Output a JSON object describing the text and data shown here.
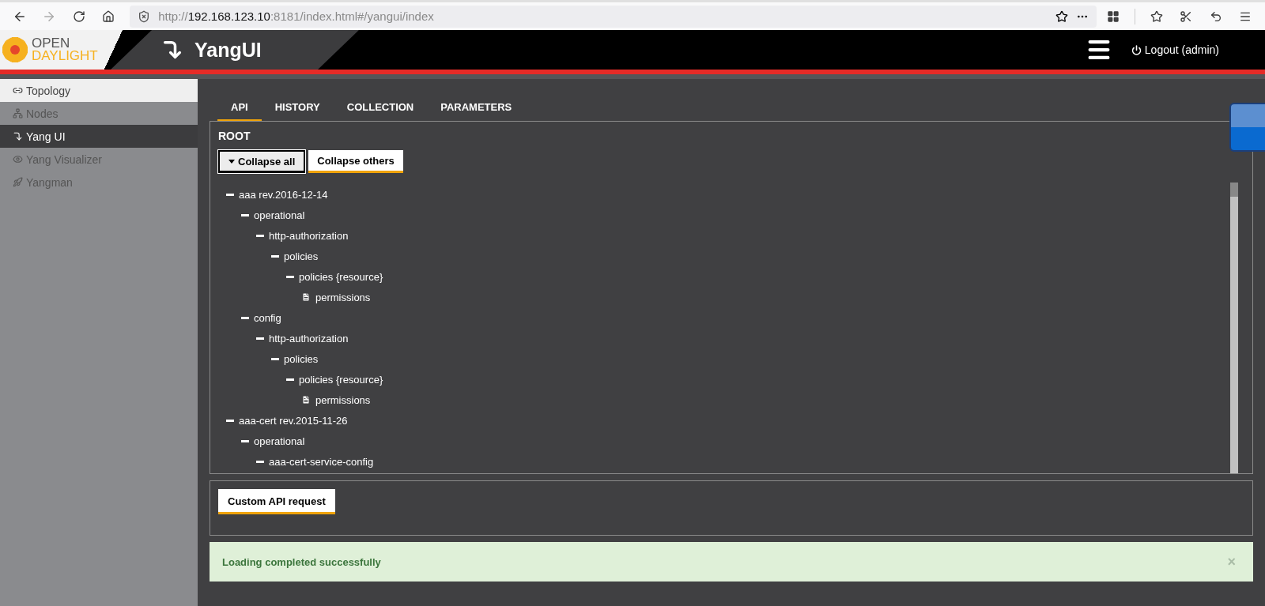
{
  "browser": {
    "url": {
      "scheme": "http://",
      "host": "192.168.123.10",
      "rest": ":8181/index.html#/yangui/index"
    }
  },
  "header": {
    "logo": {
      "line1": "OPEN",
      "line2": "DAYLIGHT"
    },
    "title": "YangUI",
    "logout": "Logout (admin)"
  },
  "sidebar": {
    "items": [
      {
        "label": "Topology",
        "selected": false,
        "highlighted": true,
        "kind": "link"
      },
      {
        "label": "Nodes",
        "selected": false,
        "highlighted": false,
        "kind": "sitemap"
      },
      {
        "label": "Yang UI",
        "selected": true,
        "highlighted": false,
        "kind": "arrow"
      },
      {
        "label": "Yang Visualizer",
        "selected": false,
        "highlighted": false,
        "kind": "eye"
      },
      {
        "label": "Yangman",
        "selected": false,
        "highlighted": false,
        "kind": "rocket"
      }
    ]
  },
  "tabs": [
    {
      "label": "API",
      "selected": true
    },
    {
      "label": "HISTORY",
      "selected": false
    },
    {
      "label": "COLLECTION",
      "selected": false
    },
    {
      "label": "PARAMETERS",
      "selected": false
    }
  ],
  "tree_panel": {
    "title": "ROOT",
    "buttons": [
      {
        "label": "Collapse all",
        "focused": true,
        "caret": true
      },
      {
        "label": "Collapse others",
        "focused": false,
        "caret": false
      }
    ],
    "nodes": [
      {
        "label": "aaa rev.2016-12-14",
        "kind": "branch",
        "expanded": true,
        "children": [
          {
            "label": "operational",
            "kind": "branch",
            "expanded": true,
            "children": [
              {
                "label": "http-authorization",
                "kind": "branch",
                "expanded": true,
                "children": [
                  {
                    "label": "policies",
                    "kind": "branch",
                    "expanded": true,
                    "children": [
                      {
                        "label": "policies {resource}",
                        "kind": "branch",
                        "expanded": true,
                        "children": [
                          {
                            "label": "permissions",
                            "kind": "leaf"
                          }
                        ]
                      }
                    ]
                  }
                ]
              }
            ]
          },
          {
            "label": "config",
            "kind": "branch",
            "expanded": true,
            "children": [
              {
                "label": "http-authorization",
                "kind": "branch",
                "expanded": true,
                "children": [
                  {
                    "label": "policies",
                    "kind": "branch",
                    "expanded": true,
                    "children": [
                      {
                        "label": "policies {resource}",
                        "kind": "branch",
                        "expanded": true,
                        "children": [
                          {
                            "label": "permissions",
                            "kind": "leaf"
                          }
                        ]
                      }
                    ]
                  }
                ]
              }
            ]
          }
        ]
      },
      {
        "label": "aaa-cert rev.2015-11-26",
        "kind": "branch",
        "expanded": true,
        "children": [
          {
            "label": "operational",
            "kind": "branch",
            "expanded": true,
            "children": [
              {
                "label": "aaa-cert-service-config",
                "kind": "branch",
                "expanded": true
              }
            ]
          }
        ]
      }
    ]
  },
  "custom_panel": {
    "button": "Custom API request"
  },
  "alert": {
    "message": "Loading completed successfully",
    "close": "×"
  }
}
